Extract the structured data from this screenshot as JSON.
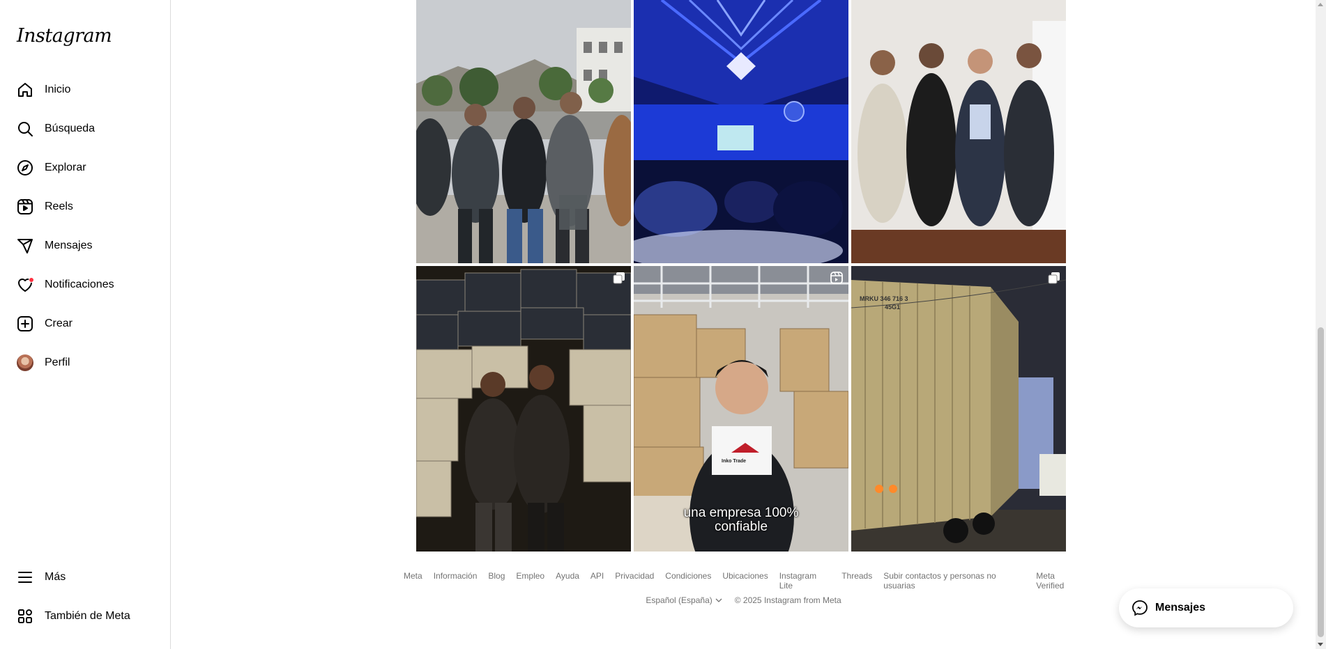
{
  "brand": {
    "logo_text": "Instagram"
  },
  "sidebar": {
    "items": [
      {
        "label": "Inicio",
        "icon": "home-icon"
      },
      {
        "label": "Búsqueda",
        "icon": "search-icon"
      },
      {
        "label": "Explorar",
        "icon": "compass-icon"
      },
      {
        "label": "Reels",
        "icon": "reels-icon"
      },
      {
        "label": "Mensajes",
        "icon": "paper-plane-icon"
      },
      {
        "label": "Notificaciones",
        "icon": "heart-icon"
      },
      {
        "label": "Crear",
        "icon": "plus-square-icon"
      },
      {
        "label": "Perfil",
        "icon": "avatar"
      }
    ],
    "bottom": [
      {
        "label": "Más",
        "icon": "menu-icon"
      },
      {
        "label": "También de Meta",
        "icon": "grid-apps-icon"
      }
    ]
  },
  "grid": {
    "tiles": [
      {
        "type": "photo",
        "badge": ""
      },
      {
        "type": "photo",
        "badge": ""
      },
      {
        "type": "photo",
        "badge": ""
      },
      {
        "type": "carousel",
        "badge": "carousel-icon"
      },
      {
        "type": "reel",
        "badge": "reel-icon",
        "caption_line1": "una empresa 100%",
        "caption_line2": "confiable",
        "sign_text": "Inko Trade"
      },
      {
        "type": "carousel",
        "badge": "carousel-icon",
        "container_code": "MRKU 346 716 3",
        "container_type": "45G1"
      }
    ]
  },
  "footer": {
    "links": [
      "Meta",
      "Información",
      "Blog",
      "Empleo",
      "Ayuda",
      "API",
      "Privacidad",
      "Condiciones",
      "Ubicaciones",
      "Instagram Lite",
      "Threads",
      "Subir contactos y personas no usuarias",
      "Meta Verified"
    ],
    "language": "Español (España)",
    "copyright": "© 2025 Instagram from Meta"
  },
  "messages_pill": {
    "label": "Mensajes",
    "icon": "messenger-icon"
  },
  "colors": {
    "notification_dot": "#ff3040",
    "text_secondary": "#737373",
    "border": "#dbdbdb"
  }
}
